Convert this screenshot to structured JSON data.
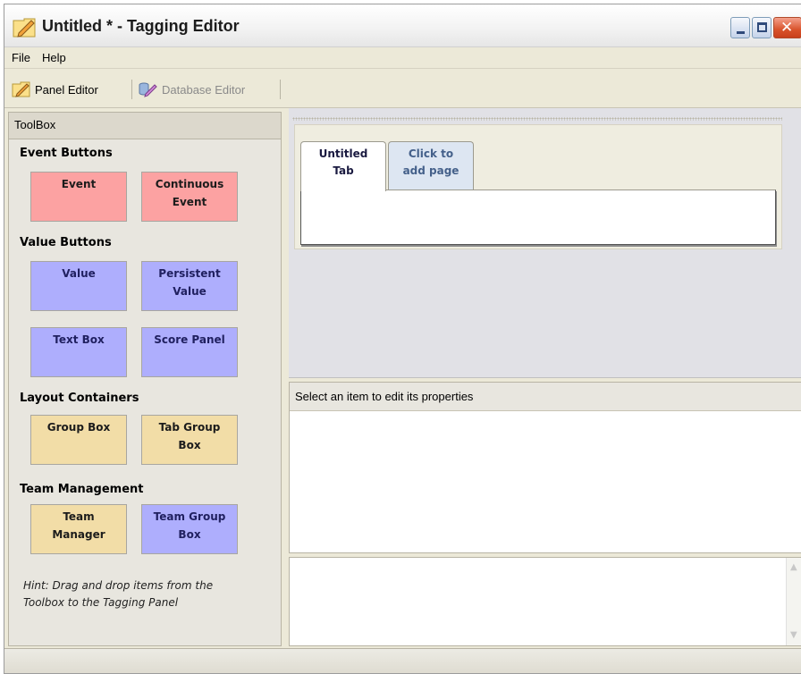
{
  "window": {
    "title": "Untitled * - Tagging Editor",
    "app_icon": "pencil-icon"
  },
  "menubar": {
    "items": [
      "File",
      "Help"
    ]
  },
  "toolbar": {
    "tabs": [
      {
        "label": "Panel Editor",
        "icon": "pencil-icon",
        "active": true
      },
      {
        "label": "Database Editor",
        "icon": "database-edit-icon",
        "active": false
      }
    ]
  },
  "toolbox": {
    "title": "ToolBox",
    "sections": [
      {
        "title": "Event Buttons",
        "items": [
          {
            "lines": [
              "Event"
            ],
            "color": "#fca2a2"
          },
          {
            "lines": [
              "Continuous",
              "Event"
            ],
            "color": "#fca2a2"
          }
        ]
      },
      {
        "title": "Value Buttons",
        "items": [
          {
            "lines": [
              "Value"
            ],
            "color": "#aeaefd"
          },
          {
            "lines": [
              "Persistent",
              "Value"
            ],
            "color": "#aeaefd"
          },
          {
            "lines": [
              "Text Box"
            ],
            "color": "#aeaefd"
          },
          {
            "lines": [
              "Score Panel"
            ],
            "color": "#aeaefd"
          }
        ]
      },
      {
        "title": "Layout Containers",
        "items": [
          {
            "lines": [
              "Group Box"
            ],
            "color": "#f2dda7"
          },
          {
            "lines": [
              "Tab Group",
              "Box"
            ],
            "color": "#f2dda7"
          }
        ]
      },
      {
        "title": "Team Management",
        "items": [
          {
            "lines": [
              "Team",
              "Manager"
            ],
            "color": "#f2dda7"
          },
          {
            "lines": [
              "Team Group",
              "Box"
            ],
            "color": "#aeaefd"
          }
        ]
      }
    ],
    "hint": [
      "Hint: Drag and drop items from the",
      "Toolbox to the Tagging Panel"
    ]
  },
  "panel": {
    "tabs": [
      {
        "lines": [
          "Untitled",
          "Tab"
        ],
        "active": true
      },
      {
        "lines": [
          "Click to",
          "add page"
        ],
        "active": false
      }
    ]
  },
  "properties": {
    "header": "Select an item to edit its properties"
  }
}
